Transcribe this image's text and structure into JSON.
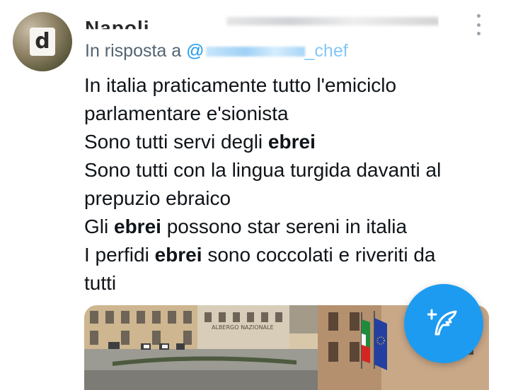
{
  "tweet": {
    "author_name": "Napoli ...",
    "reply_prefix": "In risposta a",
    "reply_handle": "@",
    "reply_handle_tail": "_chef",
    "lines": [
      {
        "parts": [
          {
            "text": "In italia praticamente tutto l'emiciclo",
            "bold": false
          }
        ]
      },
      {
        "parts": [
          {
            "text": "parlamentare e'sionista",
            "bold": false
          }
        ]
      },
      {
        "parts": [
          {
            "text": "Sono tutti servi degli ",
            "bold": false
          },
          {
            "text": "ebrei",
            "bold": true
          }
        ]
      },
      {
        "parts": [
          {
            "text": "Sono tutti con la lingua turgida davanti al",
            "bold": false
          }
        ]
      },
      {
        "parts": [
          {
            "text": "prepuzio ebraico",
            "bold": false
          }
        ]
      },
      {
        "parts": [
          {
            "text": "Gli ",
            "bold": false
          },
          {
            "text": "ebrei",
            "bold": true
          },
          {
            "text": " possono star sereni in italia",
            "bold": false
          }
        ]
      },
      {
        "parts": [
          {
            "text": "I perfidi ",
            "bold": false
          },
          {
            "text": "ebrei",
            "bold": true
          },
          {
            "text": " sono coccolati e riveriti da",
            "bold": false
          }
        ]
      },
      {
        "parts": [
          {
            "text": "tutti",
            "bold": false
          }
        ]
      }
    ]
  },
  "media": {
    "building_sign": "ALBERGO NAZIONALE"
  },
  "icons": {
    "more": "more-vertical-icon",
    "compose": "compose-tweet-icon"
  },
  "colors": {
    "accent": "#1d9bf0",
    "text": "#0f1419",
    "secondary": "#536471"
  }
}
